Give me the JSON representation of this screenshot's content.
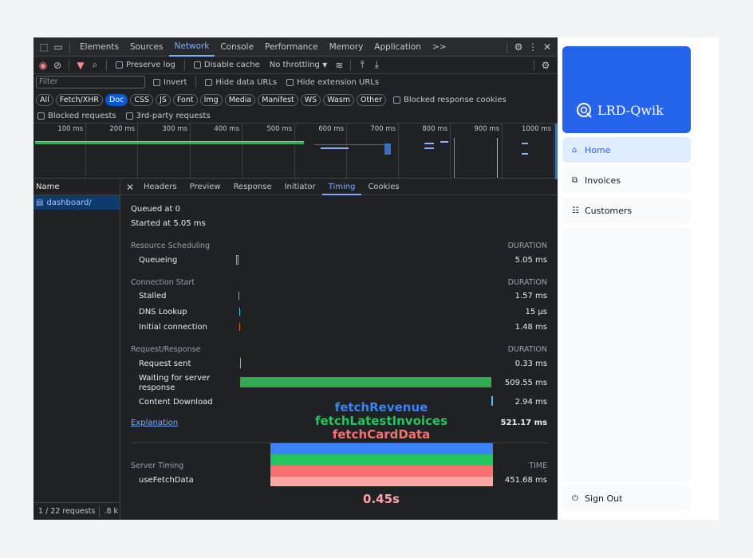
{
  "devtools": {
    "tabs": [
      "Elements",
      "Sources",
      "Network",
      "Console",
      "Performance",
      "Memory",
      "Application"
    ],
    "active_tab": "Network",
    "more_tabs": ">>",
    "toolbar": {
      "preserve_log": "Preserve log",
      "disable_cache": "Disable cache",
      "throttling": "No throttling"
    },
    "filter": {
      "placeholder": "Filter",
      "invert": "Invert",
      "hide_data_urls": "Hide data URLs",
      "hide_extension_urls": "Hide extension URLs"
    },
    "type_filters": [
      "All",
      "Fetch/XHR",
      "Doc",
      "CSS",
      "JS",
      "Font",
      "Img",
      "Media",
      "Manifest",
      "WS",
      "Wasm",
      "Other"
    ],
    "active_type": "Doc",
    "blocked_response_cookies": "Blocked response cookies",
    "blocked_requests": "Blocked requests",
    "third_party": "3rd-party requests",
    "ticks": [
      "100 ms",
      "200 ms",
      "300 ms",
      "400 ms",
      "500 ms",
      "600 ms",
      "700 ms",
      "800 ms",
      "900 ms",
      "1000 ms"
    ],
    "name_header": "Name",
    "request_name": "dashboard/",
    "footer": "1 / 22 requests",
    "footer_size": ".8 k",
    "detail_tabs": [
      "Headers",
      "Preview",
      "Response",
      "Initiator",
      "Timing",
      "Cookies"
    ],
    "active_detail_tab": "Timing",
    "timing": {
      "queued": "Queued at 0",
      "started": "Started at 5.05 ms",
      "resource_scheduling": "Resource Scheduling",
      "duration": "DURATION",
      "queueing": "Queueing",
      "queueing_val": "5.05 ms",
      "connection_start": "Connection Start",
      "stalled": "Stalled",
      "stalled_val": "1.57 ms",
      "dns": "DNS Lookup",
      "dns_val": "15 µs",
      "initial_connection": "Initial connection",
      "initial_connection_val": "1.48 ms",
      "request_response": "Request/Response",
      "request_sent": "Request sent",
      "request_sent_val": "0.33 ms",
      "waiting": "Waiting for server response",
      "waiting_val": "509.55 ms",
      "content_download": "Content Download",
      "content_download_val": "2.94 ms",
      "explanation": "Explanation",
      "total": "521.17 ms",
      "server_timing": "Server Timing",
      "time": "TIME",
      "use_fetch_data": "useFetchData",
      "use_fetch_data_val": "451.68 ms"
    }
  },
  "annotations": {
    "fetch_revenue": "fetchRevenue",
    "fetch_latest_invoices": "fetchLatestInvoices",
    "fetch_card_data": "fetchCardData",
    "duration": "0.45s",
    "colors": {
      "revenue": "#3b82f6",
      "invoices": "#22c55e",
      "card": "#f87171",
      "pink": "#fca5a5"
    }
  },
  "sidebar": {
    "logo": "LRD-Qwik",
    "items": [
      {
        "label": "Home",
        "icon": "home-icon"
      },
      {
        "label": "Invoices",
        "icon": "invoice-icon"
      },
      {
        "label": "Customers",
        "icon": "customers-icon"
      }
    ],
    "sign_out": "Sign Out",
    "brand_color": "#2563eb"
  }
}
